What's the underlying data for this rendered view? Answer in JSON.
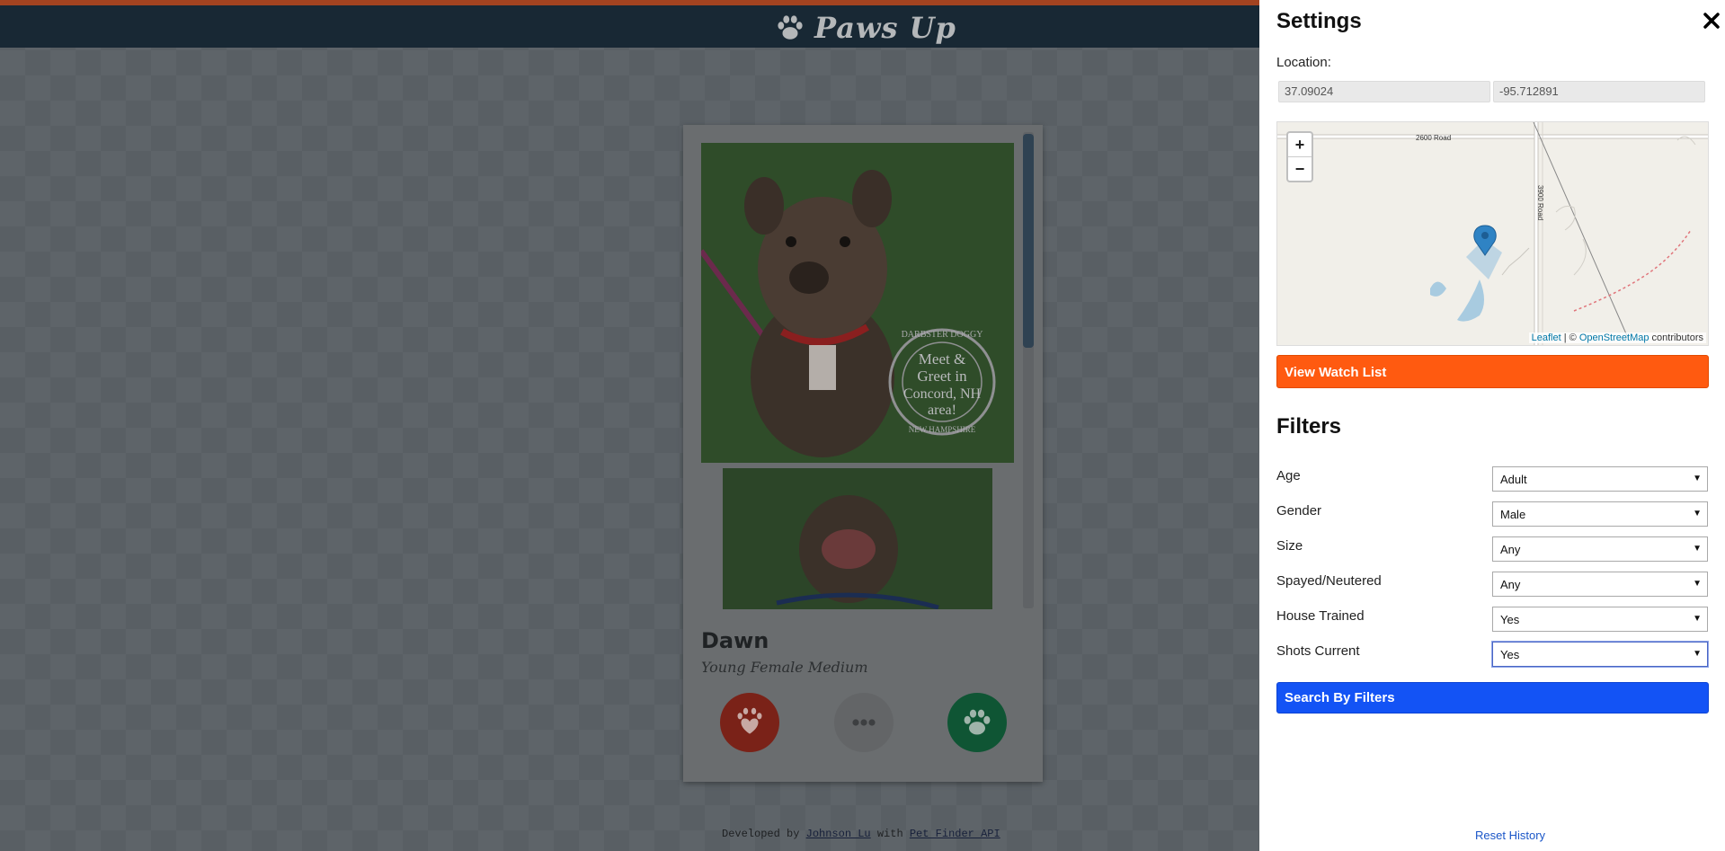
{
  "header": {
    "brand": "Paws Up",
    "accent_color": "#a34320",
    "bar_color": "#182834"
  },
  "pet": {
    "name": "Dawn",
    "description": "Young Female Medium",
    "photo_badge_lines": [
      "Meet &",
      "Greet in",
      "Concord, NH",
      "area!"
    ],
    "photo_badge_ring_top": "DARBSTER DOGGY",
    "photo_badge_ring_bottom": "NEW HAMPSHIRE",
    "actions": [
      {
        "name": "reject",
        "icon": "paw-heart-icon",
        "color": "#7a2218"
      },
      {
        "name": "more",
        "icon": "more-dots-icon",
        "color": "#636567"
      },
      {
        "name": "like",
        "icon": "paw-icon",
        "color": "#0f5534"
      }
    ]
  },
  "footer": {
    "prefix": "Developed by",
    "author": "Johnson Lu",
    "middle": "with",
    "api": "Pet Finder API"
  },
  "settings": {
    "title": "Settings",
    "close_icon": "close-icon",
    "location_label": "Location:",
    "latitude": "37.09024",
    "longitude": "-95.712891",
    "map": {
      "road_horizontal": "2600 Road",
      "road_vertical": "3900 Road",
      "zoom_in": "+",
      "zoom_out": "−",
      "attribution_leaflet": "Leaflet",
      "attribution_sep": " | © ",
      "attribution_osm": "OpenStreetMap",
      "attribution_suffix": " contributors"
    },
    "watch_list_label": "View Watch List",
    "watch_list_color": "#ff5a10",
    "filters_title": "Filters",
    "filters": [
      {
        "label": "Age",
        "value": "Adult"
      },
      {
        "label": "Gender",
        "value": "Male"
      },
      {
        "label": "Size",
        "value": "Any"
      },
      {
        "label": "Spayed/Neutered",
        "value": "Any"
      },
      {
        "label": "House Trained",
        "value": "Yes"
      },
      {
        "label": "Shots Current",
        "value": "Yes"
      }
    ],
    "search_label": "Search By Filters",
    "search_color": "#1353f5",
    "reset_label": "Reset History"
  }
}
